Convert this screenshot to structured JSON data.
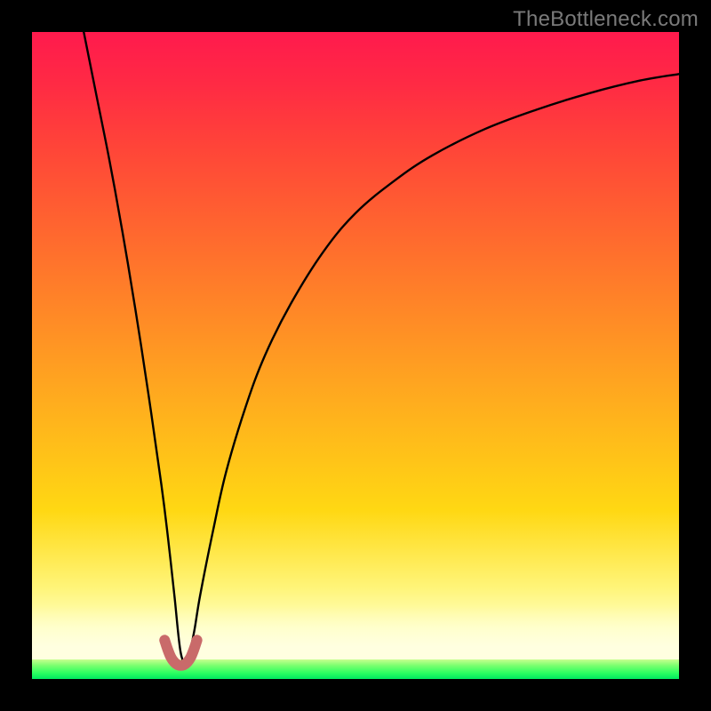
{
  "watermark": "TheBottleneck.com",
  "chart_data": {
    "type": "line",
    "title": "",
    "xlabel": "",
    "ylabel": "",
    "xlim": [
      0,
      100
    ],
    "ylim": [
      0,
      100
    ],
    "grid": false,
    "legend": false,
    "notes": "Background is a vertical heat gradient (red at top through orange/yellow to green at bottom). A single black curve descends steeply from top-left into a cusp near the bottom around x≈23, then rises with decreasing slope toward the upper-right. A short salmon marker segment sits at the cusp near the bottom.",
    "series": [
      {
        "name": "curve",
        "color": "#000000",
        "x": [
          8,
          10,
          12,
          14,
          16,
          18,
          20,
          21,
          22,
          23,
          24,
          25,
          26,
          28,
          30,
          33,
          36,
          40,
          45,
          50,
          56,
          62,
          70,
          78,
          86,
          94,
          100
        ],
        "y": [
          100,
          90,
          80,
          69,
          57,
          44,
          30,
          22,
          13,
          4,
          3,
          7,
          13,
          23,
          32,
          42,
          50,
          58,
          66,
          72,
          77,
          81,
          85,
          88,
          90.5,
          92.5,
          93.5
        ]
      },
      {
        "name": "cusp-marker",
        "color": "#cc6666",
        "x": [
          20.5,
          21.0,
          21.5,
          22.0,
          22.5,
          23.0,
          23.5,
          24.0,
          24.5,
          25.0,
          25.5
        ],
        "y": [
          6.0,
          4.5,
          3.3,
          2.6,
          2.2,
          2.1,
          2.2,
          2.6,
          3.3,
          4.5,
          6.0
        ]
      }
    ]
  }
}
